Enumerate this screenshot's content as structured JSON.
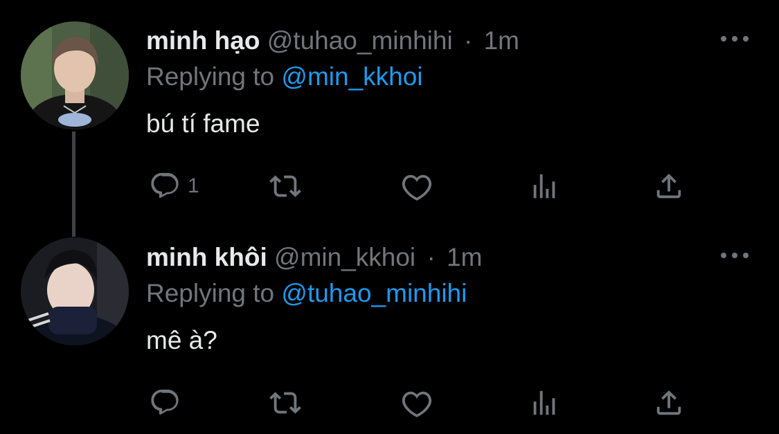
{
  "tweets": [
    {
      "name": "minh hạo",
      "handle": "@tuhao_minhihi",
      "dot": "·",
      "time": "1m",
      "replying_prefix": "Replying to",
      "replying_to": "@min_kkhoi",
      "text": "bú tí fame",
      "reply_count": "1",
      "avatar": "avatar-photo"
    },
    {
      "name": "minh khôi",
      "handle": "@min_kkhoi",
      "dot": "·",
      "time": "1m",
      "replying_prefix": "Replying to",
      "replying_to": "@tuhao_minhihi",
      "text": "mê à?",
      "reply_count": "",
      "avatar": "avatar-photo"
    }
  ],
  "icons": {
    "reply": "reply-icon",
    "retweet": "retweet-icon",
    "like": "heart-icon",
    "views": "views-icon",
    "share": "share-icon",
    "more": "more-icon"
  },
  "colors": {
    "background": "#000000",
    "text": "#e7e9ea",
    "secondary": "#71767b",
    "accent": "#1d9bf0"
  }
}
